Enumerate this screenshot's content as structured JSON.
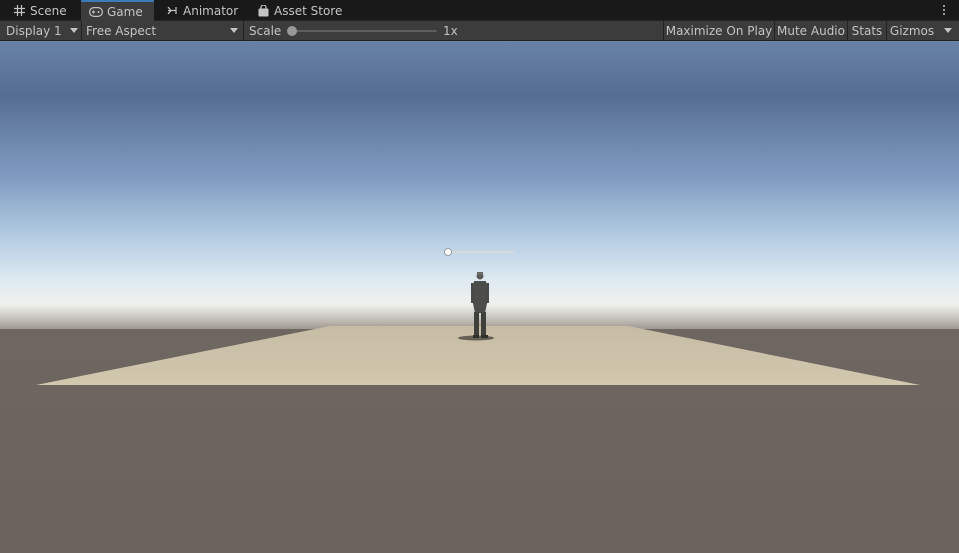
{
  "tabs": [
    {
      "label": "Scene",
      "icon": "grid-icon",
      "active": false
    },
    {
      "label": "Game",
      "icon": "gamepad-icon",
      "active": true
    },
    {
      "label": "Animator",
      "icon": "animator-icon",
      "active": false
    },
    {
      "label": "Asset Store",
      "icon": "shopping-bag-icon",
      "active": false
    }
  ],
  "toolbar": {
    "display": "Display 1",
    "aspect": "Free Aspect",
    "scale_label": "Scale",
    "scale_value": "1x",
    "scale_slider_level": 0,
    "maximize": "Maximize On Play",
    "mute": "Mute Audio",
    "stats": "Stats",
    "gizmos": "Gizmos"
  },
  "colors": {
    "accent": "#3a79bb",
    "panel": "#3c3c3c",
    "tabbar": "#191919",
    "sky_top": "#566d93",
    "sky_horizon": "#e9eef0",
    "ground": "#6b635e",
    "floor": "#c9bea4"
  },
  "scene": {
    "ui_slider_level": 0
  }
}
